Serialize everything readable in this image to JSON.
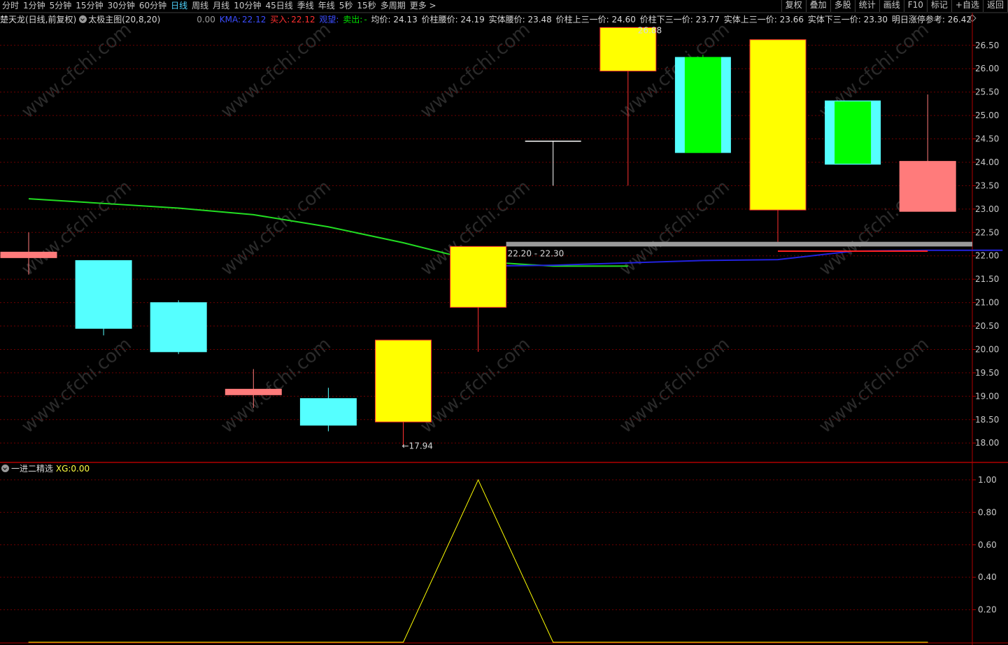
{
  "toolbar": {
    "periods": [
      "分时",
      "1分钟",
      "5分钟",
      "15分钟",
      "30分钟",
      "60分钟",
      "日线",
      "周线",
      "月线",
      "10分钟",
      "45日线",
      "季线",
      "年线",
      "5秒",
      "15秒",
      "多周期",
      "更多 >"
    ],
    "active_period": "日线",
    "buttons": [
      "复权",
      "叠加",
      "多股",
      "统计",
      "画线",
      "F10",
      "标记",
      "+自选",
      "返回"
    ]
  },
  "main_info": {
    "stock": "楚天龙(日线,前复权)",
    "indicator": "太极主图(20,8,20)",
    "v0": "0.00",
    "kma_label": "KMA:",
    "kma_value": "22.12",
    "buy_label": "买入:",
    "buy_value": "22.12",
    "watch_label": "观望:",
    "sell_label": "卖出:",
    "sell_value": "-",
    "avg": "均价: 24.13",
    "waist": "价柱腰价: 24.19",
    "body_waist": "实体腰价: 23.48",
    "upper_third": "价柱上三一价: 24.60",
    "lower_third": "价柱下三一价: 23.77",
    "body_upper_third": "实体上三一价: 23.66",
    "body_lower_third": "实体下三一价: 23.30",
    "limit_ref": "明日涨停参考: 26.42"
  },
  "sub_info": {
    "name": "一进二精选",
    "xg_label": "XG:",
    "xg_value": "0.00"
  },
  "colors": {
    "up_yellow": "#ffff00",
    "up_border": "#ff3030",
    "down_cyan": "#55ffff",
    "down_green": "#00ff00",
    "doji_pink": "#ff7b7b",
    "kma_green": "#22dd22",
    "kma_blue": "#2222dd",
    "grid_red": "#6e0000",
    "axis_red": "#b00000"
  },
  "chart_data": [
    {
      "type": "candlestick",
      "ylim": [
        17.6,
        26.9
      ],
      "yticks": [
        "26.50",
        "26.00",
        "25.50",
        "25.00",
        "24.50",
        "24.00",
        "23.50",
        "23.00",
        "22.50",
        "22.00",
        "21.50",
        "21.00",
        "20.50",
        "20.00",
        "19.50",
        "19.00",
        "18.50",
        "18.00"
      ],
      "candles": [
        {
          "open": 22.0,
          "high": 22.5,
          "low": 21.6,
          "close": 22.08,
          "style": "doji"
        },
        {
          "open": 21.9,
          "high": 21.9,
          "low": 20.3,
          "close": 20.45,
          "style": "down"
        },
        {
          "open": 21.0,
          "high": 21.05,
          "low": 19.9,
          "close": 19.95,
          "style": "down"
        },
        {
          "open": 19.15,
          "high": 19.58,
          "low": 18.75,
          "close": 19.05,
          "style": "doji"
        },
        {
          "open": 18.95,
          "high": 19.18,
          "low": 18.25,
          "close": 18.38,
          "style": "down"
        },
        {
          "open": 18.45,
          "high": 20.2,
          "low": 17.94,
          "close": 20.2,
          "style": "up"
        },
        {
          "open": 20.9,
          "high": 22.2,
          "low": 19.95,
          "close": 22.2,
          "style": "up"
        },
        {
          "open": 24.45,
          "high": 24.45,
          "low": 23.5,
          "close": 24.45,
          "style": "doji_line"
        },
        {
          "open": 25.95,
          "high": 26.88,
          "low": 23.5,
          "close": 26.88,
          "style": "up"
        },
        {
          "open": 26.25,
          "high": 26.3,
          "low": 24.2,
          "close": 24.2,
          "style": "green",
          "shadow_top": 26.25,
          "shadow_bottom": 24.2
        },
        {
          "open": 22.98,
          "high": 26.62,
          "low": 22.3,
          "close": 26.62,
          "style": "up"
        },
        {
          "open": 25.3,
          "high": 25.3,
          "low": 23.97,
          "close": 23.97,
          "style": "green",
          "shadow_top": 25.32,
          "shadow_bottom": 23.95
        },
        {
          "open": 24.02,
          "high": 25.45,
          "low": 22.95,
          "close": 22.95,
          "style": "pink"
        }
      ],
      "kma": {
        "green": [
          23.22,
          23.12,
          23.02,
          22.88,
          22.62,
          22.28,
          21.88,
          21.78,
          21.78
        ],
        "blue": [
          21.78,
          21.8,
          21.85,
          21.9,
          21.92,
          22.1,
          22.12,
          22.12
        ]
      },
      "annotations": {
        "high_label": "26.88",
        "low_label": "←17.94",
        "zone_label": "22.20 - 22.30",
        "zone_low": 22.2,
        "zone_high": 22.3,
        "buy_line": 22.1
      }
    },
    {
      "type": "line",
      "name": "XG",
      "ylim": [
        0,
        1.06
      ],
      "yticks": [
        "1.00",
        "0.80",
        "0.60",
        "0.40",
        "0.20"
      ],
      "values": [
        0,
        0,
        0,
        0,
        0,
        0,
        1,
        0,
        0,
        0,
        0,
        0,
        0
      ]
    }
  ],
  "watermark": "www.cfchi.com"
}
